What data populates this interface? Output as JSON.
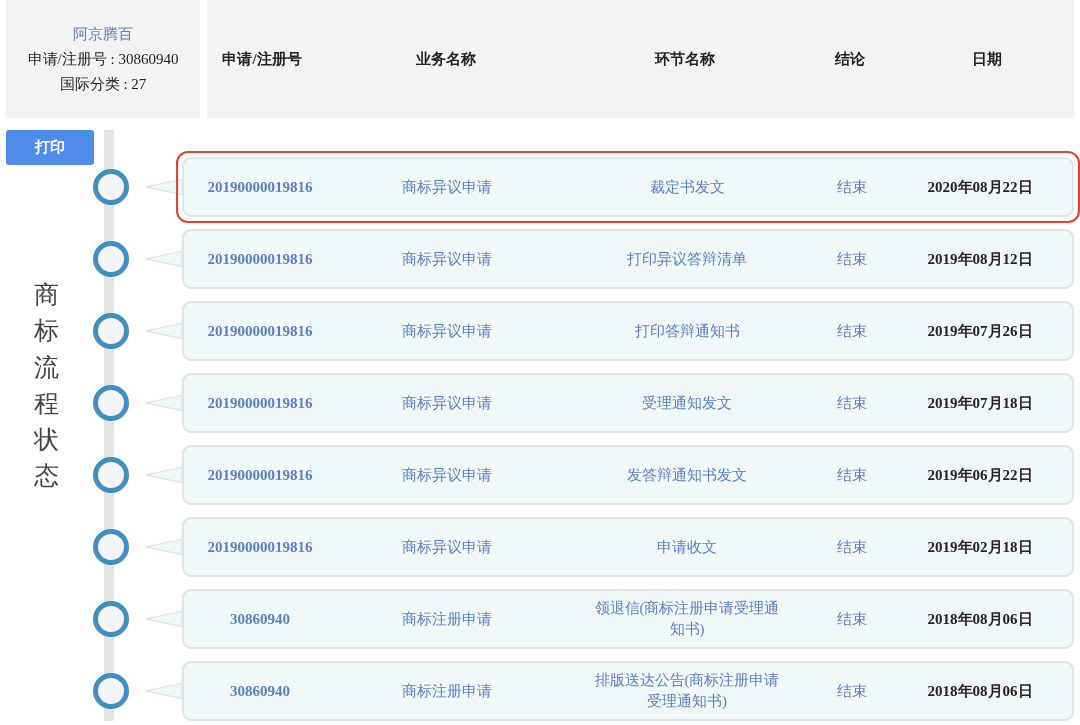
{
  "mark": {
    "name": "阿京腾百",
    "reg_no": "申请/注册号 : 30860940",
    "class": "国际分类 : 27"
  },
  "columns": [
    "申请/注册号",
    "业务名称",
    "环节名称",
    "结论",
    "日期"
  ],
  "print_button": "打印",
  "side_title": "商标流程状态",
  "rows": [
    {
      "reg_no": "20190000019816",
      "business": "商标异议申请",
      "step": "裁定书发文",
      "result": "结束",
      "date": "2020年08月22日",
      "selected": true
    },
    {
      "reg_no": "20190000019816",
      "business": "商标异议申请",
      "step": "打印异议答辩清单",
      "result": "结束",
      "date": "2019年08月12日",
      "selected": false
    },
    {
      "reg_no": "20190000019816",
      "business": "商标异议申请",
      "step": "打印答辩通知书",
      "result": "结束",
      "date": "2019年07月26日",
      "selected": false
    },
    {
      "reg_no": "20190000019816",
      "business": "商标异议申请",
      "step": "受理通知发文",
      "result": "结束",
      "date": "2019年07月18日",
      "selected": false
    },
    {
      "reg_no": "20190000019816",
      "business": "商标异议申请",
      "step": "发答辩通知书发文",
      "result": "结束",
      "date": "2019年06月22日",
      "selected": false
    },
    {
      "reg_no": "20190000019816",
      "business": "商标异议申请",
      "step": "申请收文",
      "result": "结束",
      "date": "2019年02月18日",
      "selected": false
    },
    {
      "reg_no": "30860940",
      "business": "商标注册申请",
      "step": "领退信(商标注册申请受理通知书)",
      "result": "结束",
      "date": "2018年08月06日",
      "selected": false
    },
    {
      "reg_no": "30860940",
      "business": "商标注册申请",
      "step": "排版送达公告(商标注册申请受理通知书)",
      "result": "结束",
      "date": "2018年08月06日",
      "selected": false
    }
  ]
}
